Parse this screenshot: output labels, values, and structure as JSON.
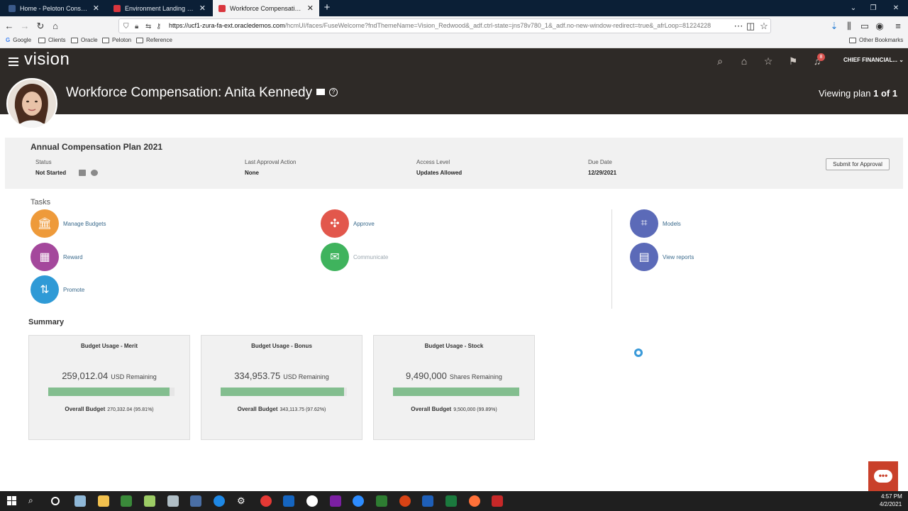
{
  "browser": {
    "tabs": [
      {
        "title": "Home - Peloton Consulting Gr",
        "favicon_color": "#3b5a8a",
        "active": false
      },
      {
        "title": "Environment Landing Page",
        "favicon_color": "#d9363e",
        "active": false
      },
      {
        "title": "Workforce Compensation - Or",
        "favicon_color": "#d9363e",
        "active": true
      }
    ],
    "new_tab_label": "+",
    "url_host": "https://ucf1-zura-fa-ext.oracledemos.com",
    "url_path": "/hcmUI/faces/FuseWelcome?fndThemeName=Vision_Redwood&_adf.ctrl-state=jns78v780_1&_adf.no-new-window-redirect=true&_afrLoop=81224228",
    "bookmarks": [
      "Google",
      "Clients",
      "Oracle",
      "Peloton",
      "Reference"
    ],
    "other_bookmarks": "Other Bookmarks"
  },
  "app": {
    "logo": "vision",
    "user_menu": "CHIEF FINANCIAL...",
    "notification_count": "8",
    "page_title": "Workforce Compensation: Anita Kennedy",
    "viewing_plan_prefix": "Viewing plan",
    "viewing_plan_current": "1 of 1"
  },
  "plan": {
    "title": "Annual Compensation Plan 2021",
    "status_label": "Status",
    "status_value": "Not Started",
    "approval_label": "Last Approval Action",
    "approval_value": "None",
    "access_label": "Access Level",
    "access_value": "Updates Allowed",
    "due_label": "Due Date",
    "due_value": "12/29/2021",
    "submit_label": "Submit for Approval"
  },
  "tasks": {
    "heading": "Tasks",
    "items": [
      {
        "label": "Manage Budgets",
        "icon": "bank-icon",
        "color": "#ee9a3a"
      },
      {
        "label": "Reward",
        "icon": "reward-icon",
        "color": "#a4489c"
      },
      {
        "label": "Promote",
        "icon": "promote-icon",
        "color": "#2f9ad6"
      },
      {
        "label": "Approve",
        "icon": "approve-icon",
        "color": "#e2574c"
      },
      {
        "label": "Communicate",
        "icon": "mail-icon",
        "color": "#3fb35d"
      },
      {
        "label": "Models",
        "icon": "models-icon",
        "color": "#5b6ab8"
      },
      {
        "label": "View reports",
        "icon": "report-icon",
        "color": "#5b6ab8"
      }
    ]
  },
  "summary": {
    "heading": "Summary",
    "cards": [
      {
        "title": "Budget Usage - Merit",
        "remaining": "259,012.04",
        "unit": "USD Remaining",
        "overall_label": "Overall Budget",
        "overall_value": "270,332.04 (95.81%)",
        "fraction": 0.9581
      },
      {
        "title": "Budget Usage - Bonus",
        "remaining": "334,953.75",
        "unit": "USD Remaining",
        "overall_label": "Overall Budget",
        "overall_value": "343,113.75 (97.62%)",
        "fraction": 0.9762
      },
      {
        "title": "Budget Usage - Stock",
        "remaining": "9,490,000",
        "unit": "Shares Remaining",
        "overall_label": "Overall Budget",
        "overall_value": "9,500,000 (99.89%)",
        "fraction": 0.9989
      }
    ]
  },
  "taskbar": {
    "time": "4:57 PM",
    "date": "4/2/2021"
  }
}
